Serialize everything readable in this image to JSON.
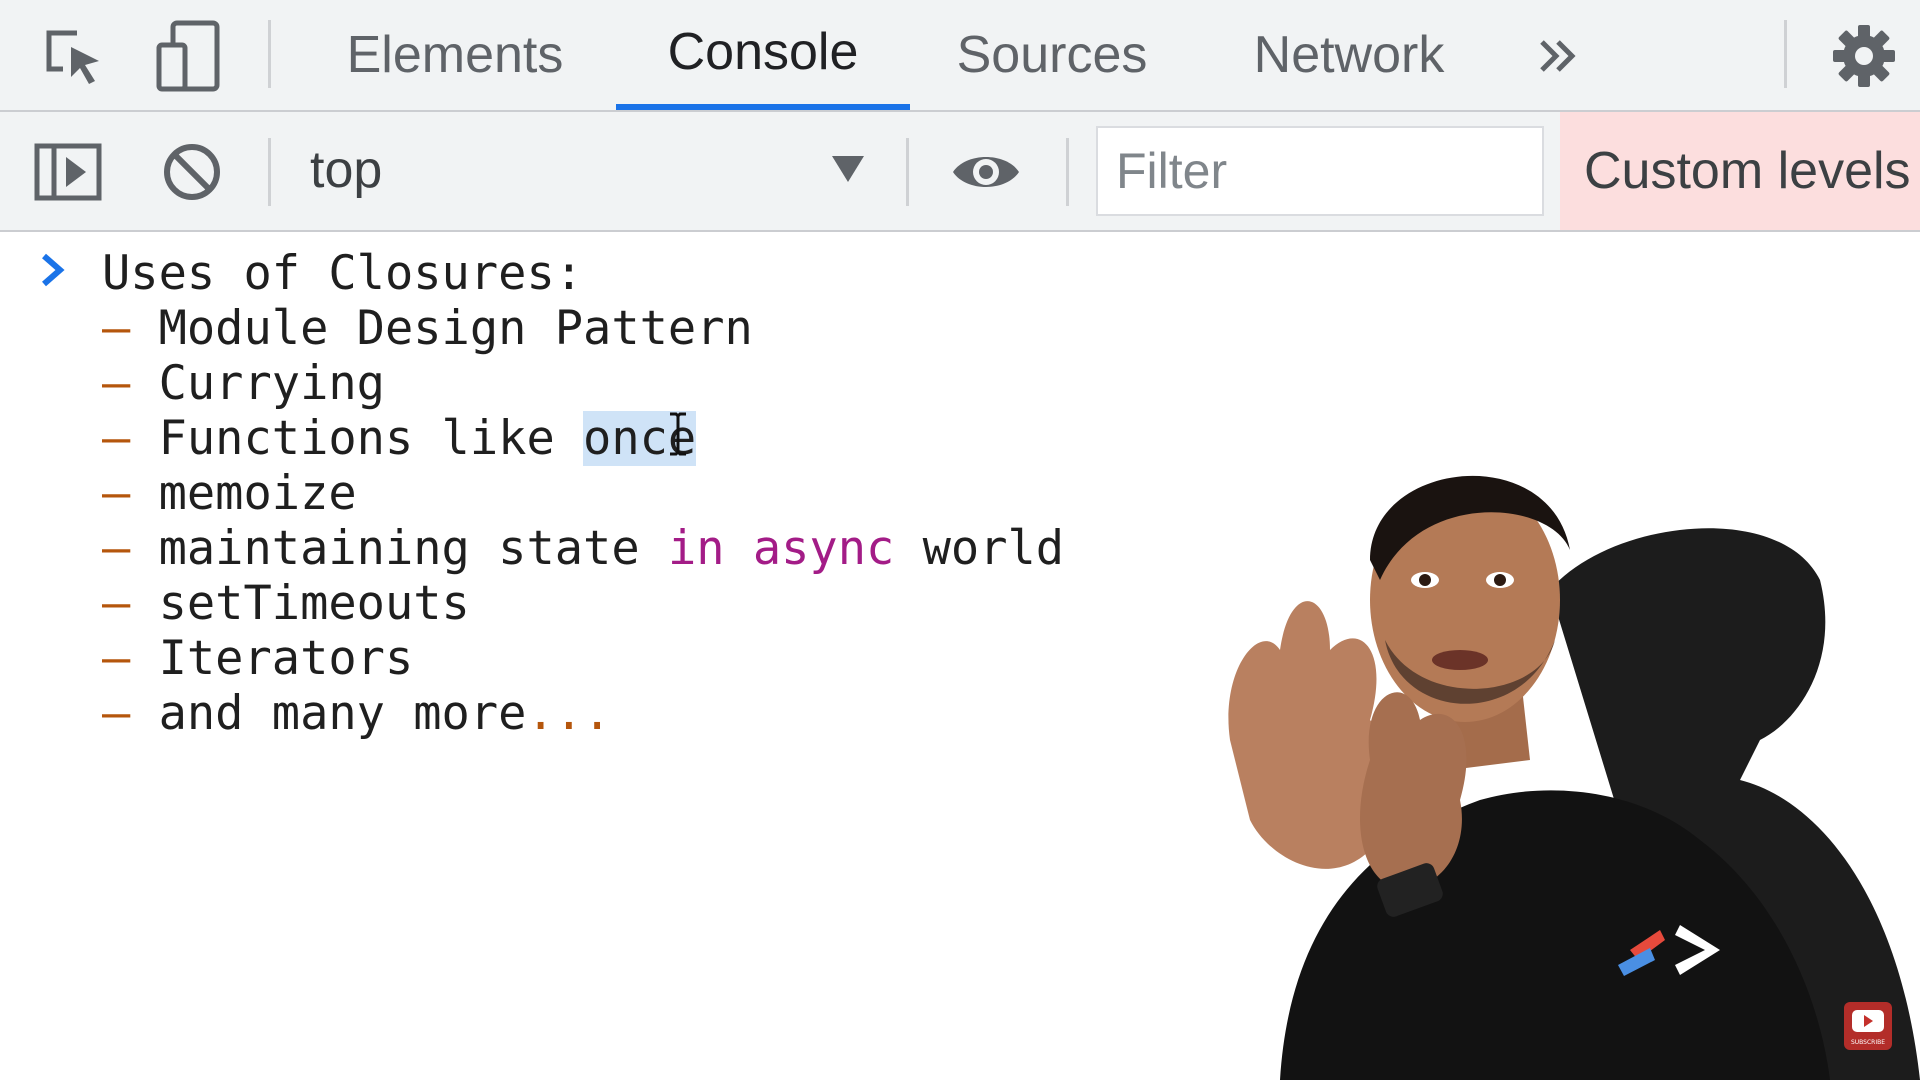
{
  "tabs": [
    {
      "label": "Elements",
      "active": false
    },
    {
      "label": "Console",
      "active": true
    },
    {
      "label": "Sources",
      "active": false
    },
    {
      "label": "Network",
      "active": false
    }
  ],
  "icons": {
    "inspect": "inspect-element-icon",
    "device": "device-toolbar-icon",
    "more_tabs": "chevron-double-right-icon",
    "settings": "gear-icon",
    "sidebar": "sidebar-toggle-icon",
    "clear": "clear-console-icon",
    "dropdown": "dropdown-arrow-icon",
    "live_expression": "eye-icon",
    "prompt": "prompt-chevron-icon",
    "subscribe": "youtube-subscribe-icon"
  },
  "toolbar": {
    "context": "top",
    "filter_placeholder": "Filter",
    "filter_value": "",
    "levels_label": "Custom levels"
  },
  "console": {
    "heading": "Uses of Closures:",
    "items": [
      "Module Design Pattern",
      "Currying",
      "Functions like ",
      "memoize",
      "maintaining state ",
      "setTimeouts",
      "Iterators",
      "and many more"
    ],
    "functions_selected_word": "once",
    "state_keyword": "in async",
    "state_tail": " world",
    "ellipsis": "...",
    "dash": "–"
  },
  "overlay": {
    "subscribe_text": "SUBSCRIBE"
  },
  "colors": {
    "tab_active_underline": "#1a73e8",
    "prompt_chevron": "#1a73e8",
    "levels_background": "#fcdede",
    "dash": "#b5560c",
    "keyword": "#a31c87",
    "selection": "#cfe3f7"
  }
}
